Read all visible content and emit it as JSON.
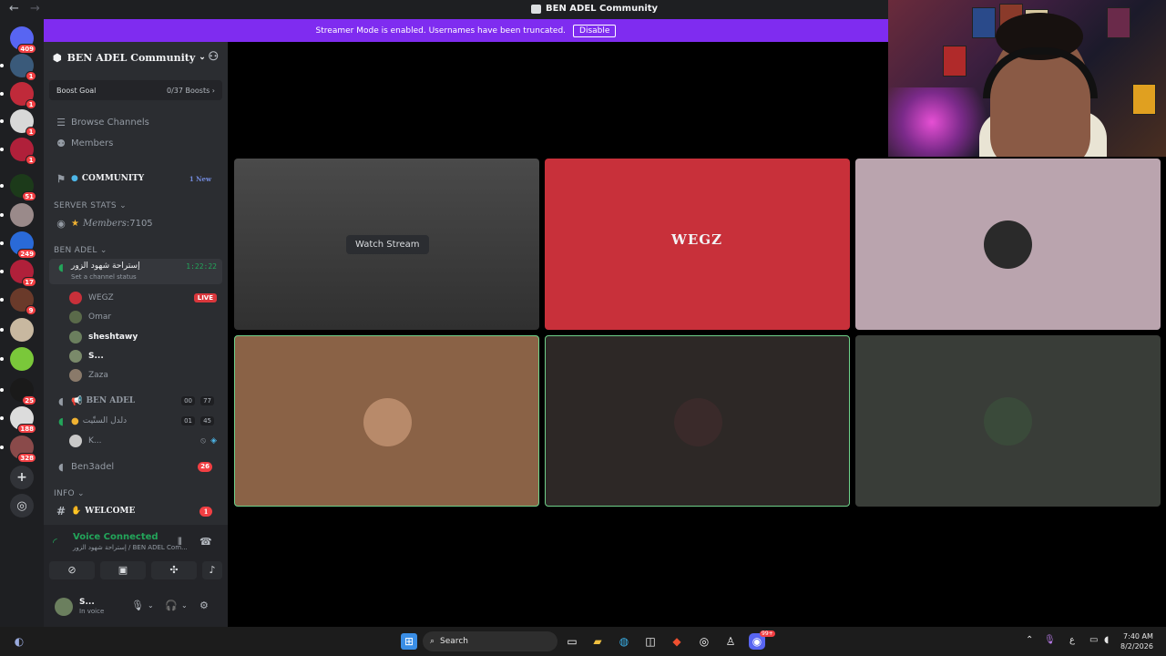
{
  "window": {
    "title": "BEN ADEL Community",
    "nav_back": "←",
    "nav_forward": "→"
  },
  "banner": {
    "text": "Streamer Mode is enabled. Usernames have been truncated.",
    "disable_label": "Disable"
  },
  "guilds": [
    {
      "icon": "discord-home-icon",
      "badge": "409",
      "color": "#5865f2"
    },
    {
      "icon": "server-avatar-icon",
      "badge": "1",
      "color": "#3a5a7a"
    },
    {
      "icon": "ea-icon",
      "badge": "1",
      "color": "#c02a3a"
    },
    {
      "icon": "server-avatar-icon",
      "badge": "1",
      "color": "#d8d8d8"
    },
    {
      "icon": "ea-icon",
      "badge": "1",
      "color": "#b0203a"
    },
    {
      "icon": "server-avatar-icon",
      "badge": "51",
      "color": "#1c3a1a"
    },
    {
      "icon": "server-avatar-icon",
      "badge": "",
      "color": "#9a8a8a"
    },
    {
      "icon": "server-avatar-icon",
      "badge": "249",
      "color": "#2a6ad8"
    },
    {
      "icon": "ea-icon",
      "badge": "17",
      "color": "#b0203a"
    },
    {
      "icon": "server-avatar-icon",
      "badge": "9",
      "color": "#6a3a2a"
    },
    {
      "icon": "server-avatar-icon",
      "badge": "",
      "color": "#c8b8a0"
    },
    {
      "icon": "server-avatar-icon",
      "badge": "",
      "color": "#7ac83a"
    },
    {
      "icon": "tnt-icon",
      "badge": "25",
      "color": "#1a1a1a"
    },
    {
      "icon": "server-avatar-icon",
      "badge": "188",
      "color": "#dcdcdc"
    },
    {
      "icon": "server-avatar-icon",
      "badge": "328",
      "color": "#8a4a4a"
    }
  ],
  "rail_actions": {
    "add_server": "+",
    "discover": "◎"
  },
  "sidebar": {
    "server_name": "BEN ADEL Community",
    "boost_label": "Boost Goal",
    "boost_value": "0/37 Boosts",
    "browse_channels": "Browse Channels",
    "members": "Members",
    "community_label": "COMMUNITY",
    "community_new": "1 New",
    "cat_server_stats": "SERVER STATS",
    "members_stat_label": "Members",
    "members_stat_value": "7105",
    "cat_ben_adel": "BEN ADEL",
    "voice_channel": "إستراحة شهود الزور",
    "voice_time": "1:22:22",
    "channel_status": "Set a channel status",
    "users": [
      {
        "name": "WEGZ",
        "live": "LIVE",
        "color": "#c8303a"
      },
      {
        "name": "Omar",
        "live": "",
        "color": "#5a6a4a"
      },
      {
        "name": "sheshtawy",
        "live": "",
        "color": "#6b7f5e"
      },
      {
        "name": "S...",
        "live": "",
        "color": "#7a8a6a"
      },
      {
        "name": "Zaza",
        "live": "",
        "color": "#8a7a6a"
      }
    ],
    "ben_adel_channel": "BEN ADEL",
    "ben_adel_count_a": "00",
    "ben_adel_count_b": "77",
    "arabic_channel": "دلدل الستّيت",
    "arabic_count_a": "01",
    "arabic_count_b": "45",
    "k_user": "K...",
    "ben3adel": "Ben3adel",
    "ben3adel_badge": "26",
    "cat_info": "INFO",
    "welcome": "WELCOME",
    "welcome_badge": "1"
  },
  "voice_panel": {
    "title": "Voice Connected",
    "subtitle": "إستراحة شهود الزور / BEN ADEL Com...",
    "me_name": "S...",
    "me_status": "In voice"
  },
  "stage": {
    "watch_stream": "Watch Stream",
    "wegz_logo": "WEGZ"
  },
  "tiles": [
    {
      "name": "stream-tile-wegz-screen",
      "bg": "#3a3a3a",
      "selected": false
    },
    {
      "name": "stream-tile-wegz",
      "bg": "#c8303a",
      "selected": false
    },
    {
      "name": "stream-tile-omar",
      "bg": "#baa4ae",
      "selected": false
    },
    {
      "name": "stream-tile-sheshtawy",
      "bg": "#8a6246",
      "selected": true
    },
    {
      "name": "stream-tile-s",
      "bg": "#2d2826",
      "selected": true
    },
    {
      "name": "stream-tile-zaza",
      "bg": "#393d38",
      "selected": false
    }
  ],
  "taskbar": {
    "search_label": "Search",
    "lang": "ع",
    "time": "7:40 AM",
    "date": "8/2/2026",
    "discord_badge": "99+"
  }
}
